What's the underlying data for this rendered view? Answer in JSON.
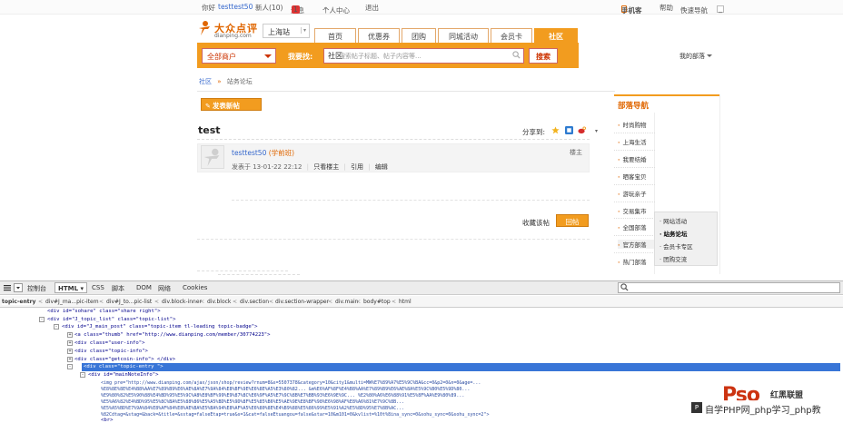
{
  "topbar": {
    "greeting": "你好",
    "username": "testtest50",
    "newbie": "新人(10)",
    "messages_label": "消息",
    "messages_count": "1",
    "personal_center": "个人中心",
    "logout": "退出",
    "mobile": "手机客",
    "help": "帮助",
    "quick_nav": "快速导航"
  },
  "header": {
    "logo_text": "大众点评",
    "logo_sub": "dianping.com",
    "city": "上海站",
    "nav_tabs": [
      "首页",
      "优惠券",
      "团购",
      "同城活动",
      "会员卡",
      "社区"
    ],
    "active_tab": "社区"
  },
  "search": {
    "category": "全部商户",
    "label": "我要找:",
    "scope": "社区",
    "placeholder": "搜索帖子标题、帖子内容等...",
    "button": "搜索",
    "my_tribe": "我的部落"
  },
  "breadcrumb": {
    "root": "社区",
    "sep": "»",
    "current": "站务论坛"
  },
  "post_button": "发表新帖",
  "topic": {
    "title": "test",
    "share_label": "分享到:",
    "author": "testtest50",
    "rank": "(学前班)",
    "floor_label": "楼主",
    "meta_posted": "发表于 13-01-22 22:12",
    "meta_only_author": "只看楼主",
    "meta_quote": "引用",
    "meta_edit": "编辑",
    "favorite": "收藏该帖",
    "reply": "回帖"
  },
  "sidebar": {
    "title": "部落导航",
    "items": [
      "时尚购物",
      "上海生活",
      "我要结婚",
      "晒客宝贝",
      "游玩亲子",
      "交易集市",
      "全国部落",
      "官方部落",
      "热门部落"
    ],
    "active_item": "官方部落",
    "submenu": [
      "网站活动",
      "站务论坛",
      "会员卡专区",
      "团购交流"
    ],
    "current_sub": "站务论坛"
  },
  "devtools": {
    "console": "控制台",
    "html": "HTML",
    "css": "CSS",
    "script": "脚本",
    "dom": "DOM",
    "net": "网络",
    "cookies": "Cookies",
    "crumbs": [
      "topic-entry",
      "div#J_ma...pic-item",
      "div#J_to...pic-list",
      "div.block-inner",
      "div.block",
      "div.section",
      "div.section-wrapper",
      "div.main",
      "body#top",
      "html"
    ],
    "lines": [
      "<div id=\"sohare\" class=\"share right\">",
      "<div id=\"J_topic_list\" class=\"topic-list\">",
      "<div id=\"J_main_post\" class=\"topic-item tl-leading topic-badge\">",
      "<a class=\"thumb\" href=\"http://www.dianping.com/member/30774223\">",
      "<div class=\"user-info\">",
      "<div class=\"topic-info\">",
      "<div class=\"getcoin-info\"> </div>",
      "<div class=\"topic-entry \">",
      "<div id=\"mainNoteInfo\">",
      "<img pre=\"http://www.dianping.com/ajax/json/shop/review?rnum=8&s=5507378&category=10&city1&multi=MW%E7%89%A7%E5%9C%BA&cc=0&p2=0&n=0&age=...",
      "%E8%8E%8E%E4%B8%AA%E7%89%B9%E6%AE%8A%E7%9A%84%E8%BF%9E%E6%8E%A5%E3%80%82... &m%E6%AF%8F%E4%B8%AA%E7%89%B9%E6%AE%8A%E5%9C%B0%E5%9D%80...",
      "%E9%80%82%E5%90%88%E4%BD%95%E5%9C%A8%E8%BF%99%E9%87%8C%E6%9F%A5%E7%9C%8B%E7%BB%93%E6%9E%9C... %E2%80%A6%E6%88%91%E5%8F%AA%E9%80%89...",
      "%E5%A6%82%E4%BD%95%E5%8C%BA%E5%88%86%E5%A5%BD%E5%9D%8F%E5%85%B6%E5%AE%9E%E8%BF%98%E6%98%AF%E8%A6%81%E7%9C%8B...",
      "%E5%A5%BD%E7%9A%84%E8%AF%84%E8%AE%BA%E5%BA%94%E8%AF%A5%E6%80%8E%E4%B9%88%E5%86%99%E5%91%A2%E5%8D%95%E7%8B%AC...",
      "%82Cdtag=&stag=&back=&title=&sstag=falseEtap=true&s=1&cat=falseEtuangou=false&star=10&m101=0&kvlist=%10t%8ina_sync=0&sohu_sync=0&sohu_sync=2\">",
      "<br>"
    ]
  },
  "watermark": {
    "logo": "Pso",
    "logo_sub": "红黑联盟",
    "text": "自学PHP网_php学习_php教"
  }
}
